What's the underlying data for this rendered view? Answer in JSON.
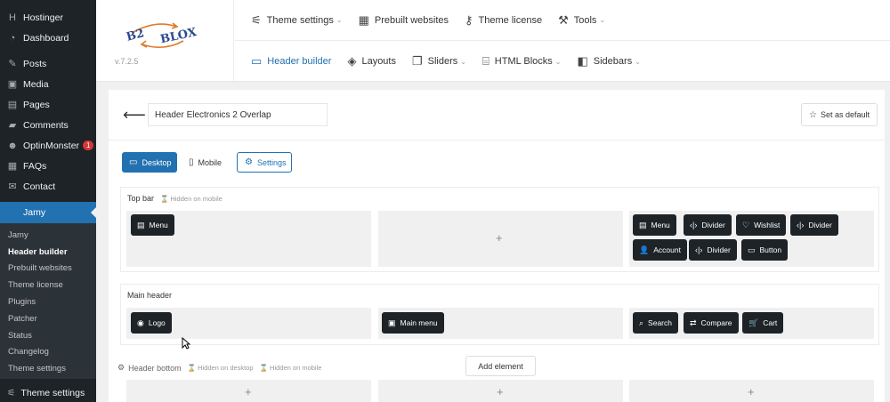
{
  "wp_menu": {
    "items": [
      {
        "label": "Hostinger",
        "icon": "hostinger-icon"
      },
      {
        "label": "Dashboard",
        "icon": "dashboard-icon"
      },
      {
        "label": "Posts",
        "icon": "pin-icon"
      },
      {
        "label": "Media",
        "icon": "media-icon"
      },
      {
        "label": "Pages",
        "icon": "page-icon"
      },
      {
        "label": "Comments",
        "icon": "comment-icon"
      },
      {
        "label": "OptinMonster",
        "icon": "optinmonster-icon",
        "badge": "1"
      },
      {
        "label": "FAQs",
        "icon": "faq-icon"
      },
      {
        "label": "Contact",
        "icon": "mail-icon"
      }
    ],
    "active": "Jamy",
    "sub_items": [
      "Jamy",
      "Header builder",
      "Prebuilt websites",
      "Theme license",
      "Plugins",
      "Patcher",
      "Status",
      "Changelog",
      "Theme settings"
    ],
    "current_sub": "Header builder",
    "bottom": "Theme settings"
  },
  "header": {
    "logo_text": "B2 BLOX",
    "version": "v.7.2.5",
    "nav_top": [
      {
        "label": "Theme settings",
        "icon": "sliders-icon",
        "dropdown": true
      },
      {
        "label": "Prebuilt websites",
        "icon": "grid-icon",
        "dropdown": false
      },
      {
        "label": "Theme license",
        "icon": "key-icon",
        "dropdown": false
      },
      {
        "label": "Tools",
        "icon": "wrench-icon",
        "dropdown": true
      }
    ],
    "nav_bottom": [
      {
        "label": "Header builder",
        "icon": "header-icon",
        "dropdown": false,
        "active": true
      },
      {
        "label": "Layouts",
        "icon": "layers-icon",
        "dropdown": false
      },
      {
        "label": "Sliders",
        "icon": "sliders-stack-icon",
        "dropdown": true
      },
      {
        "label": "HTML Blocks",
        "icon": "html-icon",
        "dropdown": true
      },
      {
        "label": "Sidebars",
        "icon": "sidebar-icon",
        "dropdown": true
      }
    ]
  },
  "builder": {
    "header_name": "Header Electronics 2 Overlap",
    "set_default": "Set as default",
    "tabs": {
      "desktop": "Desktop",
      "mobile": "Mobile",
      "settings": "Settings"
    },
    "top_bar": {
      "title": "Top bar",
      "note": "Hidden on mobile",
      "left": [
        "Menu"
      ],
      "right_row1": [
        "Menu",
        "Divider",
        "Wishlist",
        "Divider"
      ],
      "right_row2": [
        "Account",
        "Divider",
        "Button"
      ]
    },
    "main_header": {
      "title": "Main header",
      "left": [
        "Logo"
      ],
      "center": [
        "Main menu"
      ],
      "right": [
        "Search",
        "Compare",
        "Cart"
      ]
    },
    "header_bottom": {
      "title": "Header bottom",
      "note_desktop": "Hidden on desktop",
      "note_mobile": "Hidden on mobile"
    },
    "add_element": "Add element",
    "plus": "+"
  },
  "colors": {
    "wp_dark": "#1d2327",
    "accent": "#2271b1",
    "chip": "#1d2327"
  }
}
